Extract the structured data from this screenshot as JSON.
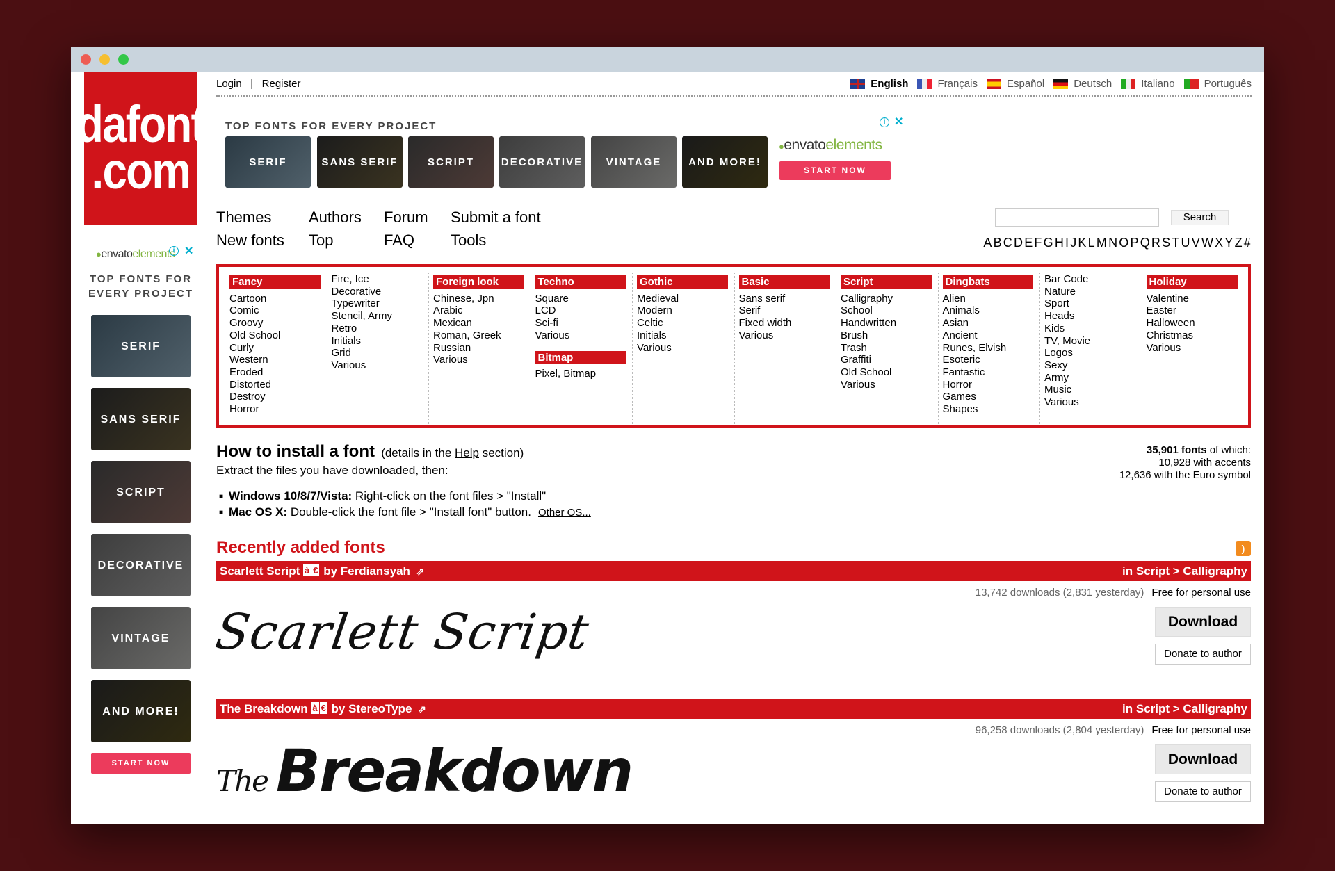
{
  "logo": {
    "line1": "dafont",
    "line2": ".com"
  },
  "auth": {
    "login": "Login",
    "sep": "|",
    "register": "Register"
  },
  "languages": [
    {
      "label": "English",
      "active": true
    },
    {
      "label": "Français",
      "active": false
    },
    {
      "label": "Español",
      "active": false
    },
    {
      "label": "Deutsch",
      "active": false
    },
    {
      "label": "Italiano",
      "active": false
    },
    {
      "label": "Português",
      "active": false
    }
  ],
  "ad": {
    "title": "TOP FONTS FOR EVERY PROJECT",
    "side_title": "TOP FONTS FOR EVERY PROJECT",
    "tiles": [
      "SERIF",
      "SANS SERIF",
      "SCRIPT",
      "DECORATIVE",
      "VINTAGE",
      "AND MORE!"
    ],
    "brand": "envato",
    "brand_suffix": "elements",
    "cta": "START NOW",
    "info": "i",
    "close": "✕"
  },
  "nav": {
    "themes": "Themes",
    "authors": "Authors",
    "forum": "Forum",
    "submit": "Submit a font",
    "new_fonts": "New fonts",
    "top": "Top",
    "faq": "FAQ",
    "tools": "Tools"
  },
  "search": {
    "button": "Search",
    "placeholder": ""
  },
  "alphabet": [
    "A",
    "B",
    "C",
    "D",
    "E",
    "F",
    "G",
    "H",
    "I",
    "J",
    "K",
    "L",
    "M",
    "N",
    "O",
    "P",
    "Q",
    "R",
    "S",
    "T",
    "U",
    "V",
    "W",
    "X",
    "Y",
    "Z",
    "#"
  ],
  "categories": [
    {
      "head": "Fancy",
      "items": [
        "Cartoon",
        "Comic",
        "Groovy",
        "Old School",
        "Curly",
        "Western",
        "Eroded",
        "Distorted",
        "Destroy",
        "Horror"
      ]
    },
    {
      "head": "",
      "items": [
        "Fire, Ice",
        "Decorative",
        "Typewriter",
        "Stencil, Army",
        "Retro",
        "Initials",
        "Grid",
        "Various"
      ]
    },
    {
      "head": "Foreign look",
      "items": [
        "Chinese, Jpn",
        "Arabic",
        "Mexican",
        "Roman, Greek",
        "Russian",
        "Various"
      ]
    },
    {
      "head": "Techno",
      "items": [
        "Square",
        "LCD",
        "Sci-fi",
        "Various"
      ],
      "head2": "Bitmap",
      "items2": [
        "Pixel, Bitmap"
      ]
    },
    {
      "head": "Gothic",
      "items": [
        "Medieval",
        "Modern",
        "Celtic",
        "Initials",
        "Various"
      ]
    },
    {
      "head": "Basic",
      "items": [
        "Sans serif",
        "Serif",
        "Fixed width",
        "Various"
      ]
    },
    {
      "head": "Script",
      "items": [
        "Calligraphy",
        "School",
        "Handwritten",
        "Brush",
        "Trash",
        "Graffiti",
        "Old School",
        "Various"
      ]
    },
    {
      "head": "Dingbats",
      "items": [
        "Alien",
        "Animals",
        "Asian",
        "Ancient",
        "Runes, Elvish",
        "Esoteric",
        "Fantastic",
        "Horror",
        "Games",
        "Shapes"
      ]
    },
    {
      "head": "",
      "items": [
        "Bar Code",
        "Nature",
        "Sport",
        "Heads",
        "Kids",
        "TV, Movie",
        "Logos",
        "Sexy",
        "Army",
        "Music",
        "Various"
      ]
    },
    {
      "head": "Holiday",
      "items": [
        "Valentine",
        "Easter",
        "Halloween",
        "Christmas",
        "Various"
      ]
    }
  ],
  "install": {
    "title": "How to install a font",
    "details_pre": "(details in the ",
    "details_link": "Help",
    "details_post": " section)",
    "extract": "Extract the files you have downloaded, then:",
    "win_label": "Windows 10/8/7/Vista:",
    "win_text": " Right-click on the font files > \"Install\"",
    "mac_label": "Mac OS X:",
    "mac_text": " Double-click the font file > \"Install font\" button.",
    "other": "Other OS..."
  },
  "stats": {
    "total": "35,901 fonts",
    "total_suffix": " of which:",
    "accents": "10,928 with accents",
    "euro": "12,636 with the Euro symbol"
  },
  "recent": {
    "title": "Recently added fonts"
  },
  "fonts": [
    {
      "name": "Scarlett Script",
      "chip_a": "à",
      "chip_e": "€",
      "by": "by Ferdiansyah",
      "category": "in Script > Calligraphy",
      "downloads": "13,742 downloads (2,831 yesterday)",
      "license": "Free for personal use",
      "download_label": "Download",
      "donate_label": "Donate to author",
      "preview": "Scarlett Script"
    },
    {
      "name": "The Breakdown",
      "chip_a": "à",
      "chip_e": "€",
      "by": "by StereoType",
      "category": "in Script > Calligraphy",
      "downloads": "96,258 downloads (2,804 yesterday)",
      "license": "Free for personal use",
      "download_label": "Download",
      "donate_label": "Donate to author",
      "preview_small": "The",
      "preview": "Breakdown"
    }
  ]
}
